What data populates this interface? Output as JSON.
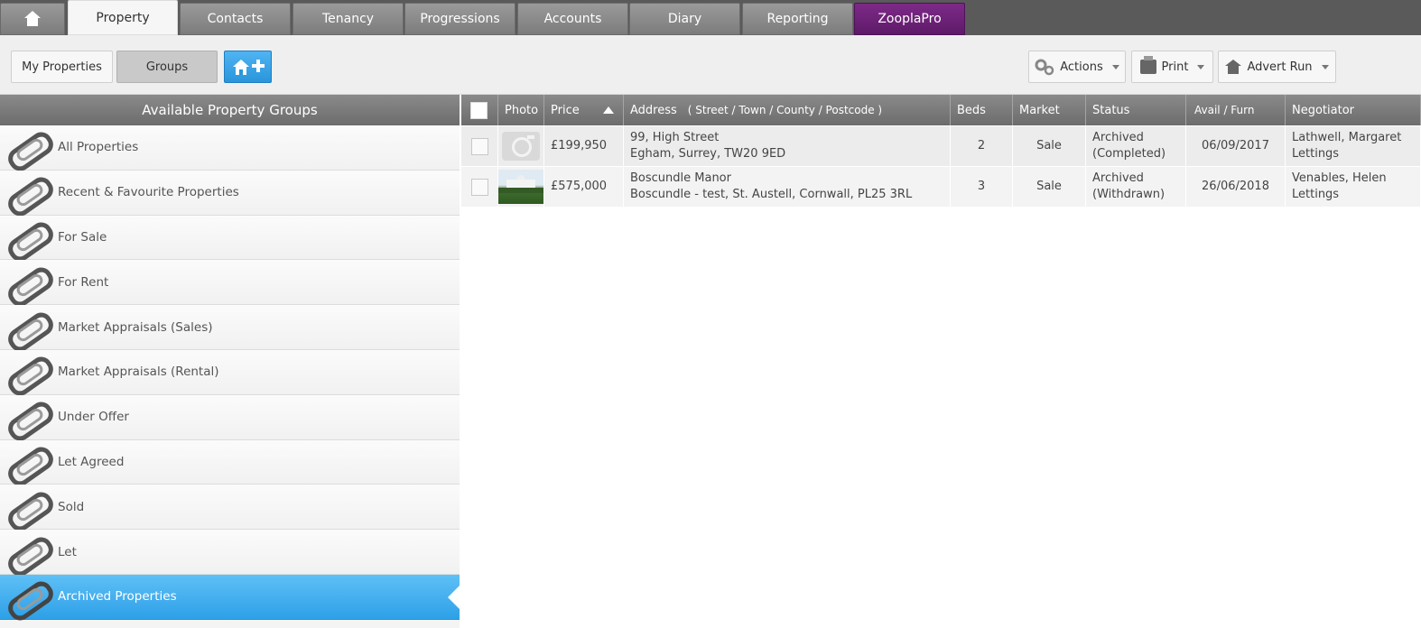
{
  "nav": {
    "home_icon": "home-icon",
    "tabs": [
      {
        "label": "Property"
      },
      {
        "label": "Contacts"
      },
      {
        "label": "Tenancy"
      },
      {
        "label": "Progressions"
      },
      {
        "label": "Accounts"
      },
      {
        "label": "Diary"
      },
      {
        "label": "Reporting"
      },
      {
        "label": "ZooplaPro"
      }
    ],
    "active_tab": "Property",
    "zoopla_color": "#6b1f76"
  },
  "toolbar": {
    "my_properties": "My Properties",
    "groups": "Groups",
    "add_property_icon": "add-property-icon",
    "actions": "Actions",
    "print": "Print",
    "advert_run": "Advert Run"
  },
  "groups": {
    "title": "Available Property Groups",
    "items": [
      {
        "label": "All Properties"
      },
      {
        "label": "Recent & Favourite Properties"
      },
      {
        "label": "For Sale"
      },
      {
        "label": "For Rent"
      },
      {
        "label": "Market Appraisals (Sales)"
      },
      {
        "label": "Market Appraisals (Rental)"
      },
      {
        "label": "Under Offer"
      },
      {
        "label": "Let Agreed"
      },
      {
        "label": "Sold"
      },
      {
        "label": "Let"
      },
      {
        "label": "Archived Properties"
      }
    ],
    "selected": "Archived Properties",
    "selected_color": "#3aa8ec"
  },
  "table": {
    "headers": {
      "photo": "Photo",
      "price": "Price",
      "address": "Address",
      "address_parts": "( Street /  Town /  County /  Postcode )",
      "beds": "Beds",
      "market": "Market",
      "status": "Status",
      "avail": "Avail /  Furn",
      "negotiator": "Negotiator"
    },
    "rows": [
      {
        "price": "£199,950",
        "address1": "99, High Street",
        "address2": "Egham, Surrey, TW20 9ED",
        "beds": "2",
        "market": "Sale",
        "status1": "Archived",
        "status2": "(Completed)",
        "avail": "06/09/2017",
        "negotiator1": "Lathwell, Margaret",
        "negotiator2": "Lettings"
      },
      {
        "price": "£575,000",
        "address1": "Boscundle Manor",
        "address2": "Boscundle - test, St. Austell, Cornwall, PL25 3RL",
        "beds": "3",
        "market": "Sale",
        "status1": "Archived",
        "status2": "(Withdrawn)",
        "avail": "26/06/2018",
        "negotiator1": "Venables, Helen",
        "negotiator2": "Lettings"
      }
    ]
  }
}
